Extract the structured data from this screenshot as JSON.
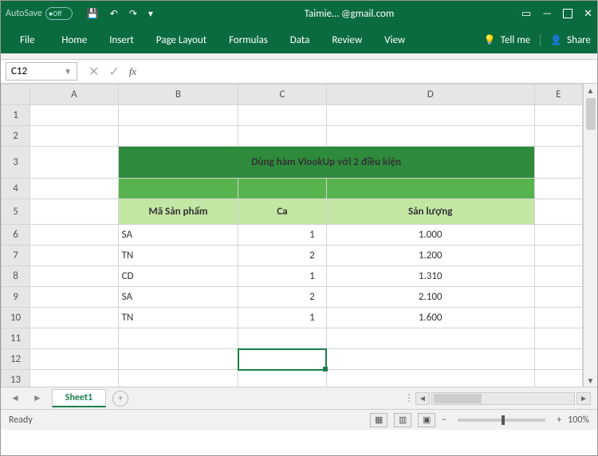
{
  "titlebar": {
    "autosave_label": "AutoSave",
    "autosave_state": "Off",
    "doc_title": "Taimie…        @gmail.com"
  },
  "ribbon": {
    "tabs": [
      "File",
      "Home",
      "Insert",
      "Page Layout",
      "Formulas",
      "Data",
      "Review",
      "View"
    ],
    "tell_me": "Tell me",
    "share": "Share"
  },
  "formula_bar": {
    "namebox": "C12",
    "fx_label": "fx"
  },
  "grid": {
    "columns": [
      "A",
      "B",
      "C",
      "D",
      "E"
    ],
    "rows": [
      "1",
      "2",
      "3",
      "4",
      "5",
      "6",
      "7",
      "8",
      "9",
      "10",
      "11",
      "12",
      "13"
    ]
  },
  "table": {
    "title": "Dùng hàm VlookUp với 2 điều kiện",
    "headers": {
      "b": "Mã Sản phẩm",
      "c": "Ca",
      "d": "Sản lượng"
    },
    "rows": [
      {
        "b": "SA",
        "c": "1",
        "d": "1.000"
      },
      {
        "b": "TN",
        "c": "2",
        "d": "1.200"
      },
      {
        "b": "CD",
        "c": "1",
        "d": "1.310"
      },
      {
        "b": "SA",
        "c": "2",
        "d": "2.100"
      },
      {
        "b": "TN",
        "c": "1",
        "d": "1.600"
      }
    ]
  },
  "sheet_tabs": {
    "active": "Sheet1"
  },
  "status": {
    "ready": "Ready",
    "zoom": "100%"
  }
}
